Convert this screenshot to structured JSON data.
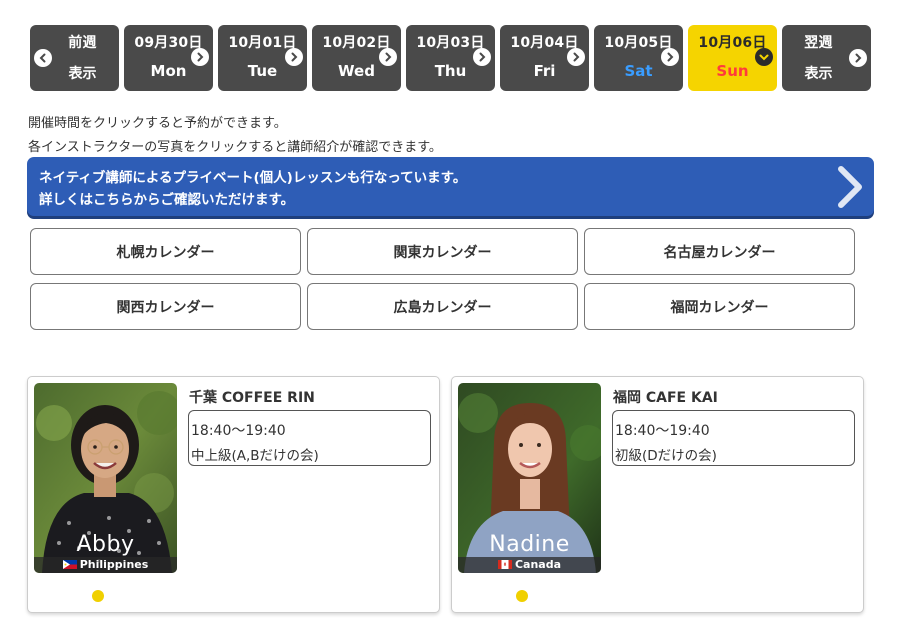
{
  "colors": {
    "day_bg": "#4a4a4a",
    "day_active_bg": "#f5d400",
    "sat": "#3a9dff",
    "sun": "#ff3b3b",
    "banner_bg": "#2e5db6",
    "dot": "#f0d000"
  },
  "daynav": {
    "prev": {
      "line1": "前週",
      "line2": "表示",
      "icon": "chevron-left-icon"
    },
    "days": [
      {
        "date": "09月30日",
        "dow": "Mon",
        "icon": "chevron-right-icon"
      },
      {
        "date": "10月01日",
        "dow": "Tue",
        "icon": "chevron-right-icon"
      },
      {
        "date": "10月02日",
        "dow": "Wed",
        "icon": "chevron-right-icon"
      },
      {
        "date": "10月03日",
        "dow": "Thu",
        "icon": "chevron-right-icon"
      },
      {
        "date": "10月04日",
        "dow": "Fri",
        "icon": "chevron-right-icon"
      },
      {
        "date": "10月05日",
        "dow": "Sat",
        "icon": "chevron-right-icon"
      },
      {
        "date": "10月06日",
        "dow": "Sun",
        "icon": "chevron-down-icon",
        "active": true
      }
    ],
    "next": {
      "line1": "翌週",
      "line2": "表示",
      "icon": "chevron-right-icon"
    }
  },
  "info": {
    "line1": "開催時間をクリックすると予約ができます。",
    "line2": "各インストラクターの写真をクリックすると講師紹介が確認できます。"
  },
  "banner": {
    "line1_a": "ネイティブ講師による",
    "line1_b": "プライベート(個人)レッスン",
    "line1_c": "も行なっています。",
    "line2": "詳しくはこちらからご確認いただけます。",
    "icon": "chevron-right-icon"
  },
  "regions": [
    "札幌カレンダー",
    "関東カレンダー",
    "名古屋カレンダー",
    "関西カレンダー",
    "広島カレンダー",
    "福岡カレンダー"
  ],
  "lessons": [
    {
      "instructor": "Abby",
      "country": "Philippines",
      "venue_city": "千葉",
      "venue_name": "COFFEE RIN",
      "time": "18:40〜19:40",
      "level": "中上級(A,Bだけの会)"
    },
    {
      "instructor": "Nadine",
      "country": "Canada",
      "venue_city": "福岡",
      "venue_name": "CAFE KAI",
      "time": "18:40〜19:40",
      "level": "初級(Dだけの会)"
    }
  ]
}
